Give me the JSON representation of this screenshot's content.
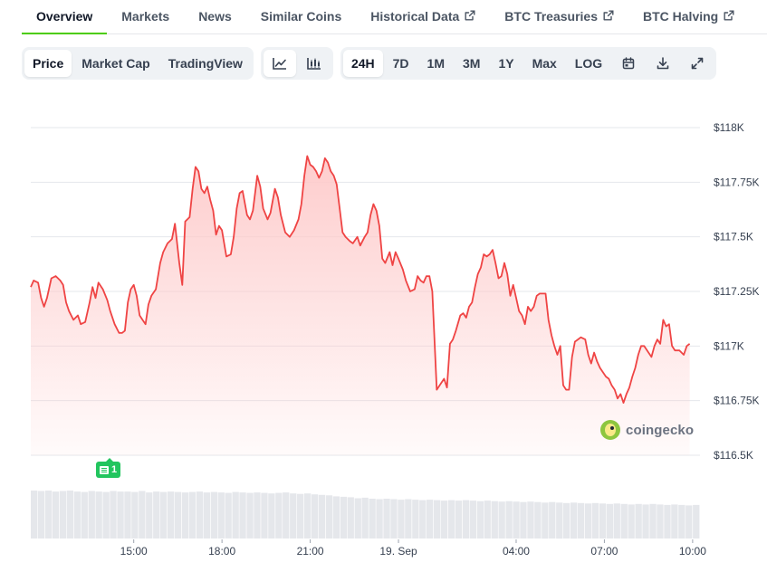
{
  "tabs": [
    {
      "label": "Overview",
      "external": false,
      "active": true
    },
    {
      "label": "Markets",
      "external": false,
      "active": false
    },
    {
      "label": "News",
      "external": false,
      "active": false
    },
    {
      "label": "Similar Coins",
      "external": false,
      "active": false
    },
    {
      "label": "Historical Data",
      "external": true,
      "active": false
    },
    {
      "label": "BTC Treasuries",
      "external": true,
      "active": false
    },
    {
      "label": "BTC Halving",
      "external": true,
      "active": false
    }
  ],
  "toolbar": {
    "chart_types": [
      {
        "label": "Price",
        "selected": true
      },
      {
        "label": "Market Cap",
        "selected": false
      },
      {
        "label": "TradingView",
        "selected": false
      }
    ],
    "view_icons": [
      {
        "icon": "line-chart-icon",
        "selected": true
      },
      {
        "icon": "candlestick-chart-icon",
        "selected": false
      }
    ],
    "ranges": [
      {
        "label": "24H",
        "selected": true
      },
      {
        "label": "7D",
        "selected": false
      },
      {
        "label": "1M",
        "selected": false
      },
      {
        "label": "3M",
        "selected": false
      },
      {
        "label": "1Y",
        "selected": false
      },
      {
        "label": "Max",
        "selected": false
      },
      {
        "label": "LOG",
        "selected": false
      }
    ],
    "action_icons": [
      "calendar-icon",
      "download-icon",
      "fullscreen-icon"
    ]
  },
  "watermark": {
    "text": "coingecko"
  },
  "event_marker": {
    "count": "1",
    "color": "#22c55e"
  },
  "colors": {
    "line": "#ef4444",
    "fill": "#fecaca",
    "active_tab": "#4bcc00",
    "grid": "#e5e7eb",
    "volume": "#e5e7eb"
  },
  "chart_data": {
    "type": "area",
    "title": "",
    "xlabel": "",
    "ylabel": "",
    "ylim": [
      116.5,
      118.0
    ],
    "y_unit": "thousand USD",
    "y_ticks": [
      {
        "value": 118.0,
        "label": "$118K"
      },
      {
        "value": 117.75,
        "label": "$117.75K"
      },
      {
        "value": 117.5,
        "label": "$117.5K"
      },
      {
        "value": 117.25,
        "label": "$117.25K"
      },
      {
        "value": 117.0,
        "label": "$117K"
      },
      {
        "value": 116.75,
        "label": "$116.75K"
      },
      {
        "value": 116.5,
        "label": "$116.5K"
      }
    ],
    "xlim": [
      11.5,
      34.25
    ],
    "x_unit": "hours from 18 Sep 00:00",
    "x_ticks": [
      {
        "value": 15,
        "label": "15:00"
      },
      {
        "value": 18,
        "label": "18:00"
      },
      {
        "value": 21,
        "label": "21:00"
      },
      {
        "value": 24,
        "label": "19. Sep"
      },
      {
        "value": 28,
        "label": "04:00"
      },
      {
        "value": 31,
        "label": "07:00"
      },
      {
        "value": 34,
        "label": "10:00"
      }
    ],
    "grid": true,
    "legend": "none",
    "series": [
      {
        "values": [
          [
            11.5,
            117.27
          ],
          [
            11.6,
            117.3
          ],
          [
            11.75,
            117.29
          ],
          [
            11.85,
            117.22
          ],
          [
            11.95,
            117.18
          ],
          [
            12.05,
            117.22
          ],
          [
            12.2,
            117.31
          ],
          [
            12.35,
            117.32
          ],
          [
            12.5,
            117.3
          ],
          [
            12.6,
            117.28
          ],
          [
            12.7,
            117.2
          ],
          [
            12.8,
            117.16
          ],
          [
            12.95,
            117.12
          ],
          [
            13.1,
            117.14
          ],
          [
            13.2,
            117.1
          ],
          [
            13.35,
            117.11
          ],
          [
            13.5,
            117.2
          ],
          [
            13.6,
            117.27
          ],
          [
            13.7,
            117.22
          ],
          [
            13.8,
            117.29
          ],
          [
            13.95,
            117.26
          ],
          [
            14.1,
            117.21
          ],
          [
            14.2,
            117.16
          ],
          [
            14.35,
            117.1
          ],
          [
            14.5,
            117.06
          ],
          [
            14.6,
            117.06
          ],
          [
            14.7,
            117.07
          ],
          [
            14.8,
            117.2
          ],
          [
            14.9,
            117.26
          ],
          [
            15.0,
            117.28
          ],
          [
            15.1,
            117.23
          ],
          [
            15.2,
            117.14
          ],
          [
            15.3,
            117.12
          ],
          [
            15.4,
            117.1
          ],
          [
            15.5,
            117.19
          ],
          [
            15.6,
            117.23
          ],
          [
            15.75,
            117.26
          ],
          [
            15.9,
            117.38
          ],
          [
            16.0,
            117.43
          ],
          [
            16.15,
            117.47
          ],
          [
            16.3,
            117.49
          ],
          [
            16.4,
            117.56
          ],
          [
            16.55,
            117.38
          ],
          [
            16.65,
            117.28
          ],
          [
            16.75,
            117.57
          ],
          [
            16.9,
            117.59
          ],
          [
            17.0,
            117.72
          ],
          [
            17.1,
            117.82
          ],
          [
            17.2,
            117.8
          ],
          [
            17.3,
            117.72
          ],
          [
            17.4,
            117.7
          ],
          [
            17.5,
            117.73
          ],
          [
            17.6,
            117.67
          ],
          [
            17.7,
            117.62
          ],
          [
            17.8,
            117.51
          ],
          [
            17.9,
            117.55
          ],
          [
            18.0,
            117.53
          ],
          [
            18.15,
            117.41
          ],
          [
            18.3,
            117.42
          ],
          [
            18.4,
            117.5
          ],
          [
            18.5,
            117.63
          ],
          [
            18.6,
            117.7
          ],
          [
            18.7,
            117.71
          ],
          [
            18.85,
            117.6
          ],
          [
            18.95,
            117.58
          ],
          [
            19.05,
            117.62
          ],
          [
            19.2,
            117.78
          ],
          [
            19.3,
            117.73
          ],
          [
            19.4,
            117.63
          ],
          [
            19.55,
            117.58
          ],
          [
            19.65,
            117.61
          ],
          [
            19.8,
            117.72
          ],
          [
            19.9,
            117.68
          ],
          [
            20.0,
            117.6
          ],
          [
            20.15,
            117.52
          ],
          [
            20.3,
            117.5
          ],
          [
            20.45,
            117.53
          ],
          [
            20.6,
            117.58
          ],
          [
            20.7,
            117.65
          ],
          [
            20.8,
            117.78
          ],
          [
            20.9,
            117.87
          ],
          [
            21.0,
            117.83
          ],
          [
            21.1,
            117.82
          ],
          [
            21.2,
            117.8
          ],
          [
            21.3,
            117.77
          ],
          [
            21.4,
            117.8
          ],
          [
            21.5,
            117.86
          ],
          [
            21.6,
            117.84
          ],
          [
            21.7,
            117.8
          ],
          [
            21.8,
            117.78
          ],
          [
            21.9,
            117.74
          ],
          [
            22.0,
            117.63
          ],
          [
            22.1,
            117.52
          ],
          [
            22.2,
            117.5
          ],
          [
            22.35,
            117.48
          ],
          [
            22.45,
            117.47
          ],
          [
            22.6,
            117.5
          ],
          [
            22.7,
            117.46
          ],
          [
            22.85,
            117.5
          ],
          [
            22.95,
            117.52
          ],
          [
            23.05,
            117.6
          ],
          [
            23.15,
            117.65
          ],
          [
            23.25,
            117.62
          ],
          [
            23.35,
            117.55
          ],
          [
            23.45,
            117.4
          ],
          [
            23.55,
            117.38
          ],
          [
            23.7,
            117.43
          ],
          [
            23.8,
            117.37
          ],
          [
            23.9,
            117.43
          ],
          [
            24.0,
            117.4
          ],
          [
            24.15,
            117.35
          ],
          [
            24.25,
            117.3
          ],
          [
            24.4,
            117.25
          ],
          [
            24.55,
            117.26
          ],
          [
            24.65,
            117.32
          ],
          [
            24.75,
            117.3
          ],
          [
            24.85,
            117.29
          ],
          [
            24.95,
            117.32
          ],
          [
            25.05,
            117.32
          ],
          [
            25.15,
            117.25
          ],
          [
            25.3,
            116.8
          ],
          [
            25.45,
            116.83
          ],
          [
            25.55,
            116.85
          ],
          [
            25.65,
            116.81
          ],
          [
            25.75,
            117.01
          ],
          [
            25.85,
            117.03
          ],
          [
            25.95,
            117.07
          ],
          [
            26.1,
            117.14
          ],
          [
            26.2,
            117.15
          ],
          [
            26.3,
            117.13
          ],
          [
            26.4,
            117.18
          ],
          [
            26.5,
            117.2
          ],
          [
            26.6,
            117.27
          ],
          [
            26.7,
            117.33
          ],
          [
            26.8,
            117.36
          ],
          [
            26.9,
            117.42
          ],
          [
            27.0,
            117.41
          ],
          [
            27.1,
            117.42
          ],
          [
            27.2,
            117.44
          ],
          [
            27.3,
            117.38
          ],
          [
            27.4,
            117.31
          ],
          [
            27.5,
            117.32
          ],
          [
            27.6,
            117.38
          ],
          [
            27.7,
            117.33
          ],
          [
            27.8,
            117.23
          ],
          [
            27.9,
            117.28
          ],
          [
            28.0,
            117.22
          ],
          [
            28.1,
            117.16
          ],
          [
            28.2,
            117.14
          ],
          [
            28.3,
            117.1
          ],
          [
            28.4,
            117.18
          ],
          [
            28.5,
            117.16
          ],
          [
            28.6,
            117.18
          ],
          [
            28.7,
            117.23
          ],
          [
            28.8,
            117.24
          ],
          [
            28.9,
            117.24
          ],
          [
            29.0,
            117.24
          ],
          [
            29.1,
            117.12
          ],
          [
            29.2,
            117.05
          ],
          [
            29.3,
            117.0
          ],
          [
            29.4,
            116.96
          ],
          [
            29.5,
            117.0
          ],
          [
            29.6,
            116.82
          ],
          [
            29.7,
            116.8
          ],
          [
            29.8,
            116.8
          ],
          [
            29.9,
            116.95
          ],
          [
            30.0,
            117.02
          ],
          [
            30.1,
            117.03
          ],
          [
            30.2,
            117.04
          ],
          [
            30.35,
            117.03
          ],
          [
            30.45,
            116.96
          ],
          [
            30.55,
            116.92
          ],
          [
            30.65,
            116.97
          ],
          [
            30.75,
            116.93
          ],
          [
            30.85,
            116.9
          ],
          [
            30.95,
            116.88
          ],
          [
            31.05,
            116.86
          ],
          [
            31.15,
            116.85
          ],
          [
            31.25,
            116.82
          ],
          [
            31.35,
            116.8
          ],
          [
            31.45,
            116.76
          ],
          [
            31.55,
            116.78
          ],
          [
            31.65,
            116.74
          ],
          [
            31.75,
            116.78
          ],
          [
            31.85,
            116.81
          ],
          [
            31.95,
            116.86
          ],
          [
            32.05,
            116.9
          ],
          [
            32.15,
            116.96
          ],
          [
            32.25,
            117.0
          ],
          [
            32.35,
            117.0
          ],
          [
            32.5,
            116.97
          ],
          [
            32.6,
            116.95
          ],
          [
            32.7,
            117.0
          ],
          [
            32.8,
            117.03
          ],
          [
            32.9,
            117.01
          ],
          [
            33.0,
            117.12
          ],
          [
            33.1,
            117.09
          ],
          [
            33.2,
            117.1
          ],
          [
            33.3,
            117.0
          ],
          [
            33.4,
            116.98
          ],
          [
            33.55,
            116.98
          ],
          [
            33.7,
            116.96
          ],
          [
            33.8,
            117.0
          ],
          [
            33.9,
            117.01
          ]
        ]
      }
    ],
    "volume": [
      1.0,
      0.99,
      1.0,
      0.98,
      0.99,
      1.0,
      0.98,
      0.97,
      0.99,
      0.98,
      0.97,
      0.99,
      0.98,
      0.98,
      0.97,
      0.99,
      0.96,
      0.98,
      0.97,
      0.98,
      0.97,
      0.96,
      0.97,
      0.98,
      0.96,
      0.97,
      0.96,
      0.95,
      0.97,
      0.96,
      0.95,
      0.96,
      0.95,
      0.94,
      0.95,
      0.96,
      0.94,
      0.93,
      0.94,
      0.92,
      0.91,
      0.9,
      0.88,
      0.87,
      0.86,
      0.84,
      0.85,
      0.83,
      0.82,
      0.83,
      0.82,
      0.81,
      0.82,
      0.81,
      0.8,
      0.81,
      0.8,
      0.79,
      0.8,
      0.79,
      0.8,
      0.79,
      0.78,
      0.79,
      0.78,
      0.77,
      0.78,
      0.77,
      0.76,
      0.77,
      0.76,
      0.75,
      0.76,
      0.75,
      0.74,
      0.75,
      0.74,
      0.73,
      0.74,
      0.73,
      0.72,
      0.73,
      0.72,
      0.71,
      0.72,
      0.71,
      0.72,
      0.71,
      0.7,
      0.71,
      0.7,
      0.69,
      0.7
    ]
  }
}
